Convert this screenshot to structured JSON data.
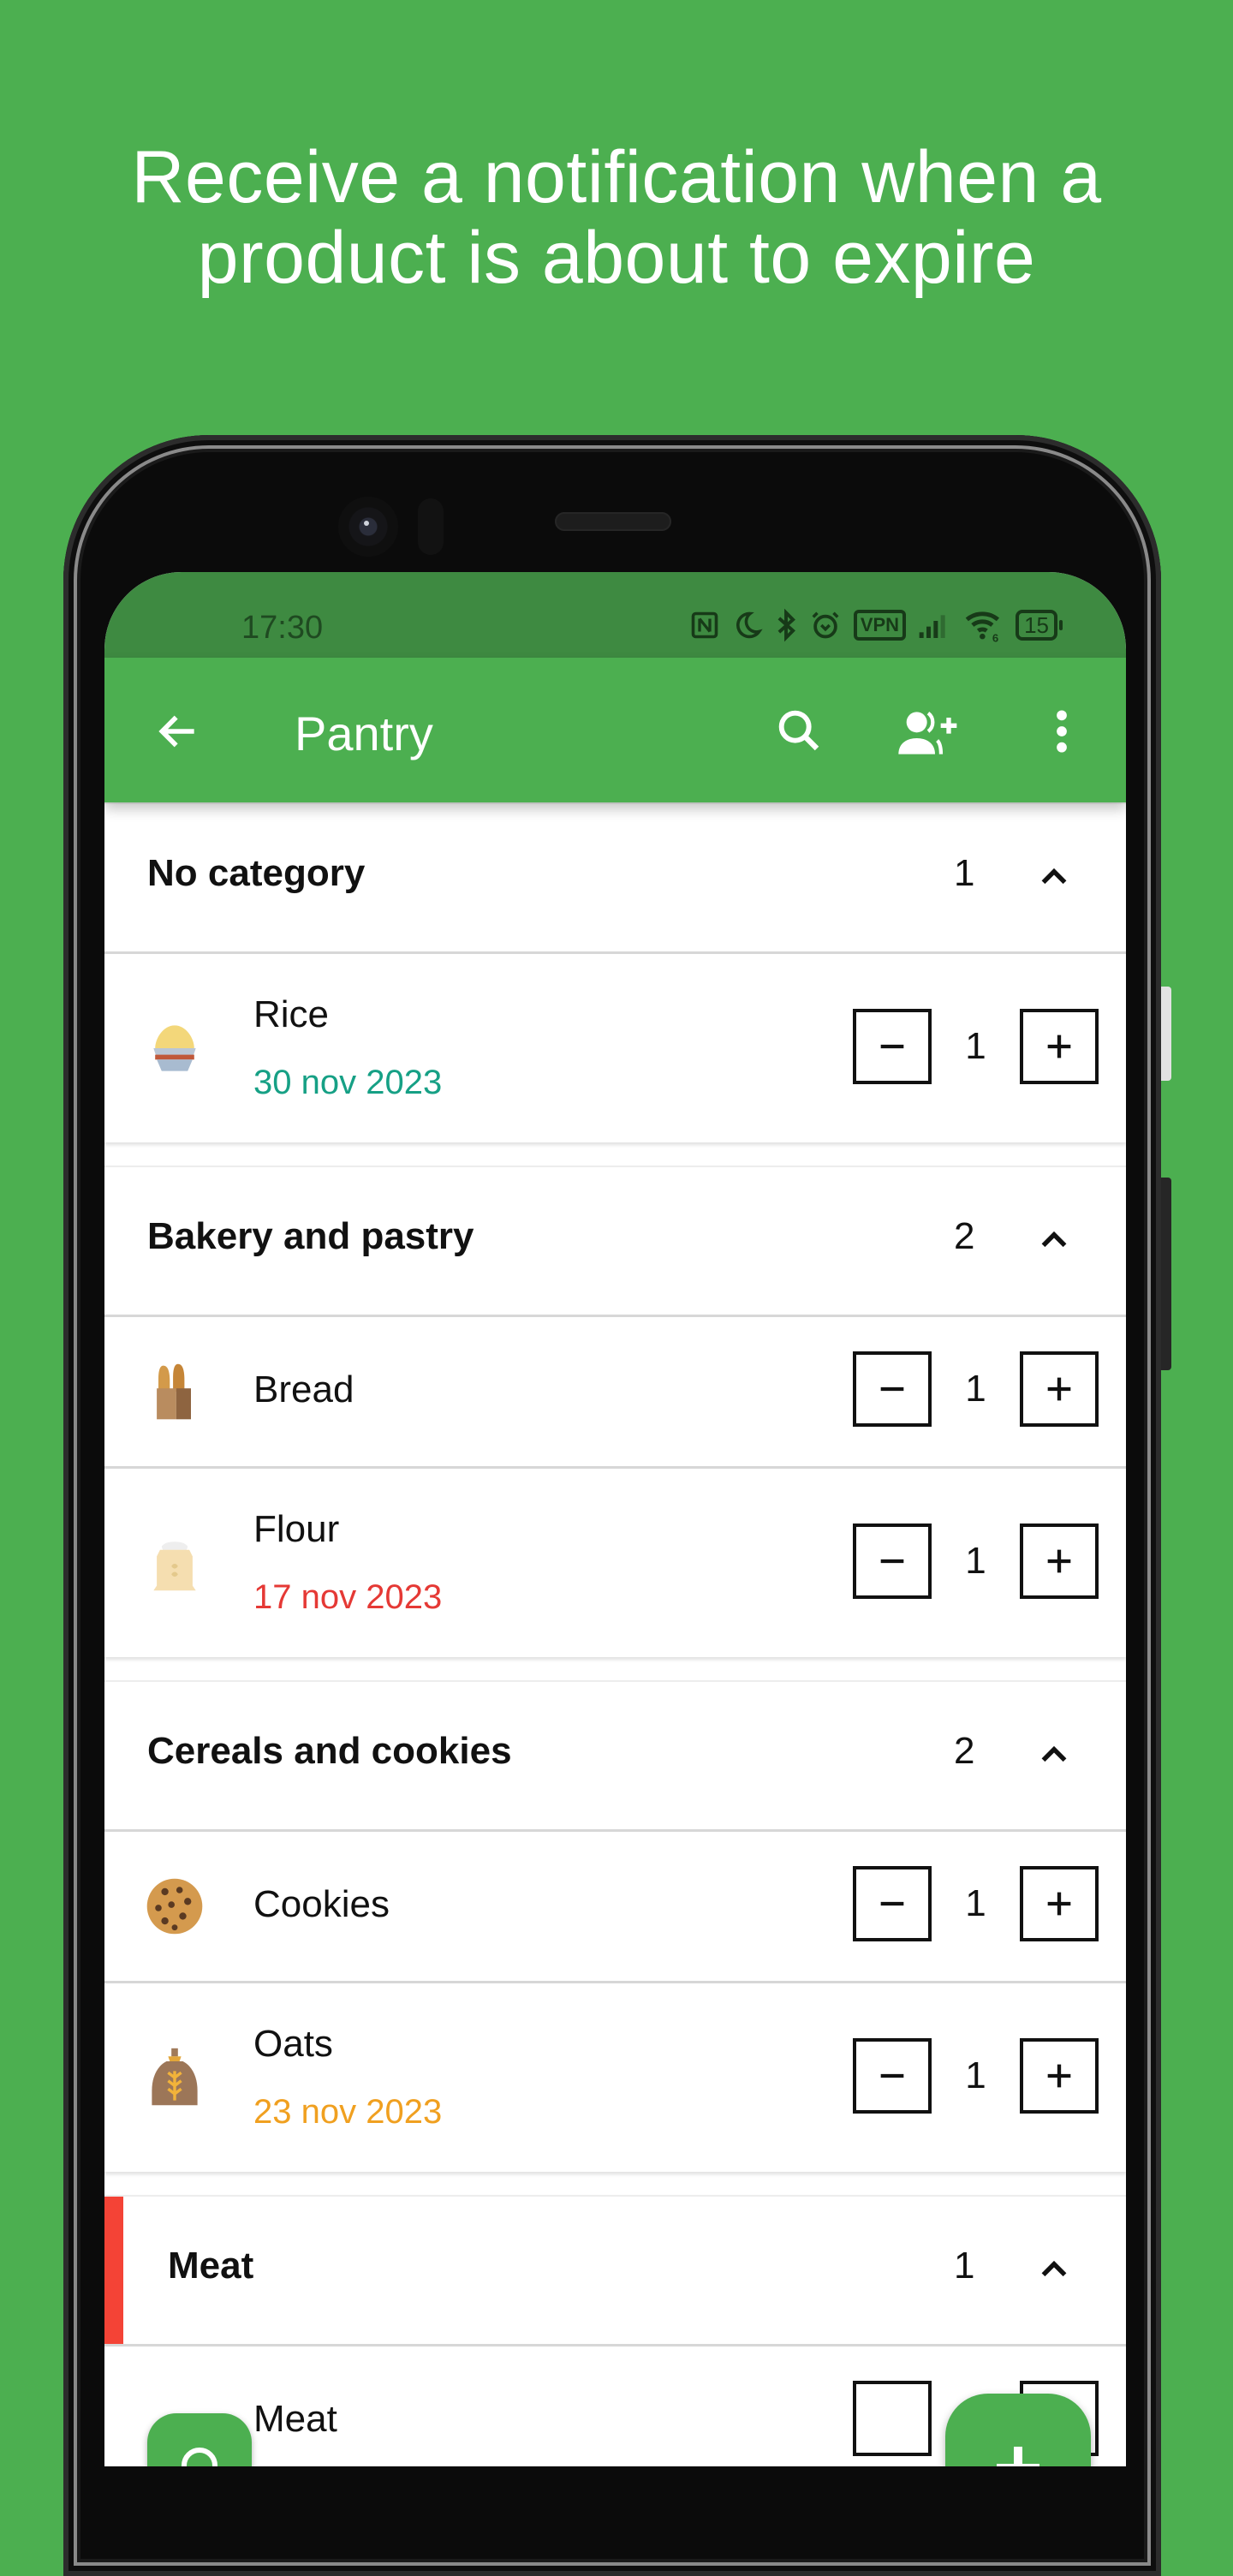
{
  "headline": {
    "line1": "Receive a notification when a",
    "line2": "product is about to expire"
  },
  "colors": {
    "brand_green": "#4caf50",
    "status_bar_green": "#3e8a41",
    "date_ok": "#16a085",
    "date_expired": "#e53935",
    "date_warning": "#f0a020",
    "category_flag_red": "#f44336"
  },
  "status_bar": {
    "time": "17:30",
    "icons": [
      "nfc-icon",
      "do-not-disturb-moon-icon",
      "bluetooth-icon",
      "alarm-icon",
      "vpn-icon",
      "signal-icon",
      "wifi-icon"
    ],
    "vpn_label": "VPN",
    "wifi_badge": "6",
    "battery_level": "15"
  },
  "app_bar": {
    "title": "Pantry",
    "actions": [
      "search-icon",
      "add-user-icon",
      "more-vert-icon"
    ]
  },
  "categories": [
    {
      "name": "No category",
      "count": "1",
      "items": [
        {
          "name": "Rice",
          "icon": "rice-bowl-icon",
          "date": "30 nov 2023",
          "date_status": "ok",
          "quantity": "1"
        }
      ]
    },
    {
      "name": "Bakery and pastry",
      "count": "2",
      "items": [
        {
          "name": "Bread",
          "icon": "bread-icon",
          "date": null,
          "quantity": "1"
        },
        {
          "name": "Flour",
          "icon": "flour-sack-icon",
          "date": "17 nov 2023",
          "date_status": "expired",
          "quantity": "1"
        }
      ]
    },
    {
      "name": "Cereals and cookies",
      "count": "2",
      "items": [
        {
          "name": "Cookies",
          "icon": "cookie-icon",
          "date": null,
          "quantity": "1"
        },
        {
          "name": "Oats",
          "icon": "oats-sack-icon",
          "date": "23 nov 2023",
          "date_status": "warning",
          "quantity": "1"
        }
      ]
    },
    {
      "name": "Meat",
      "count": "1",
      "flag_color": "#f44336",
      "items": [
        {
          "name": "Meat",
          "icon": "meat-icon",
          "date": null,
          "quantity": ""
        }
      ]
    }
  ],
  "fabs": {
    "mini": "scan-icon",
    "main": "add-icon"
  }
}
